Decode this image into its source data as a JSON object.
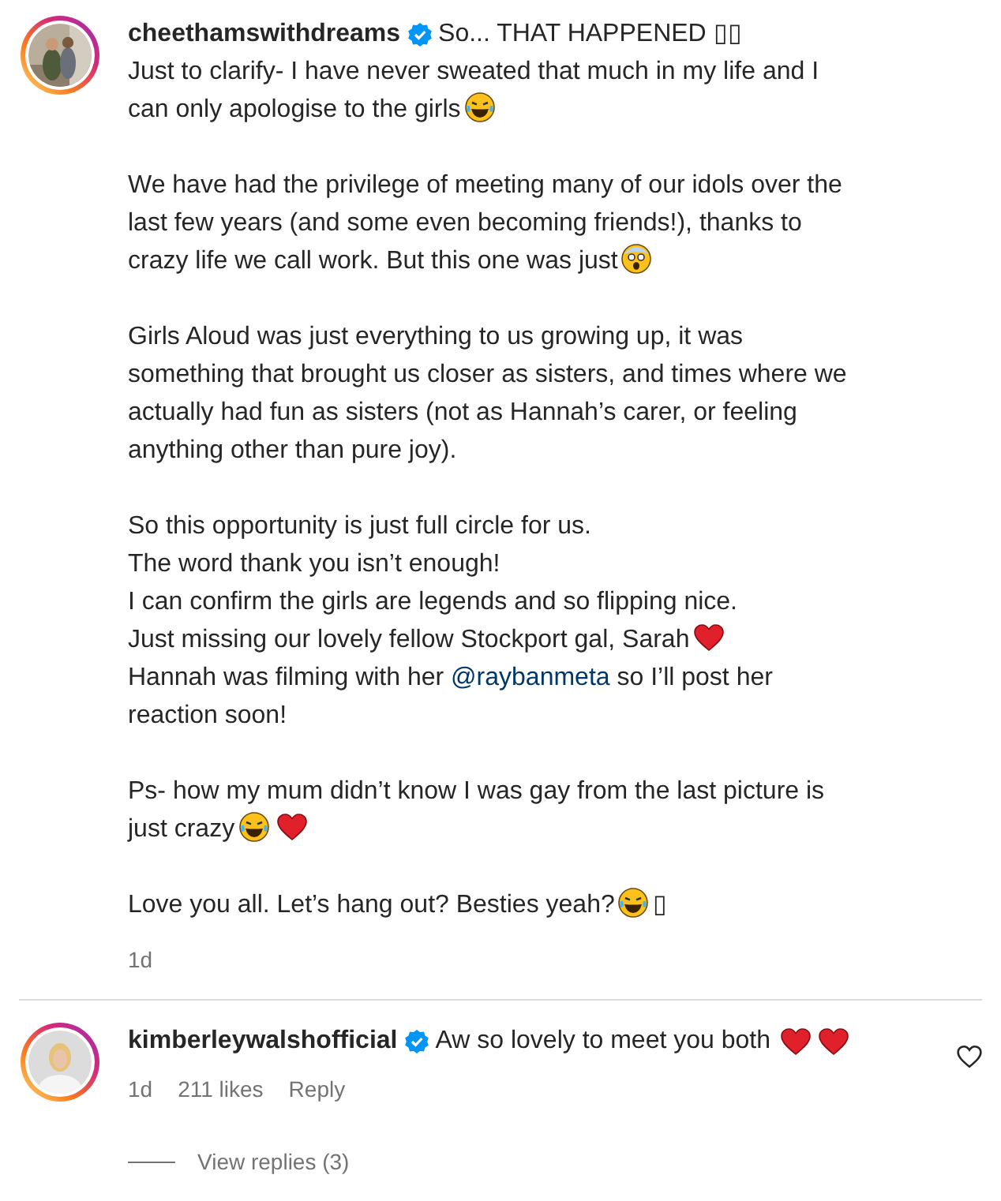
{
  "post": {
    "username": "cheethamswithdreams",
    "verified": true,
    "title": "So... THAT HAPPENED ▯▯",
    "paragraphs": [
      [
        {
          "text": "Just to clarify- I have never sweated that much in my life and I"
        },
        {
          "text": "can only apologise to the girls",
          "emojis": [
            {
              "kind": "laugh"
            }
          ]
        }
      ],
      [
        {
          "text": "We have had the privilege of meeting many of our idols over the"
        },
        {
          "text": "last few years (and some even becoming friends!), thanks to"
        },
        {
          "text": "crazy life we call work. But this one was just",
          "emojis": [
            {
              "kind": "shock"
            }
          ]
        }
      ],
      [
        {
          "text": "Girls Aloud was just everything to us growing up, it was"
        },
        {
          "text": "something that brought us closer as sisters, and times where we"
        },
        {
          "text": "actually had fun as sisters (not as Hannah’s carer, or feeling"
        },
        {
          "text": "anything other than pure joy)."
        }
      ],
      [
        {
          "text": "So this opportunity is just full circle for us."
        },
        {
          "text": "The word thank you isn’t enough!"
        },
        {
          "text": "I can confirm the girls are legends and so flipping nice."
        },
        {
          "text": "Just missing our lovely fellow Stockport gal, Sarah",
          "emojis": [
            {
              "kind": "heart"
            }
          ]
        },
        {
          "text": "Hannah was filming with her",
          "mention": "@raybanmeta",
          "after": "so I’ll post her"
        },
        {
          "text": "reaction soon!"
        }
      ],
      [
        {
          "text": "Ps- how my mum didn’t know I was gay from the last picture is"
        },
        {
          "text": "just crazy",
          "emojis": [
            {
              "kind": "laugh"
            },
            {
              "kind": "heart"
            }
          ]
        }
      ],
      [
        {
          "text": "Love you all. Let’s hang out? Besties yeah?",
          "emojis": [
            {
              "kind": "laugh"
            }
          ],
          "tail": "▯"
        }
      ]
    ],
    "time": "1d"
  },
  "comment": {
    "username": "kimberleywalshofficial",
    "verified": true,
    "text": "Aw so lovely to meet you both",
    "emojis": [
      {
        "kind": "heart"
      },
      {
        "kind": "heart"
      }
    ],
    "liked": false,
    "time": "1d",
    "likes": "211 likes",
    "reply": "Reply",
    "view_replies": "View replies (3)"
  }
}
